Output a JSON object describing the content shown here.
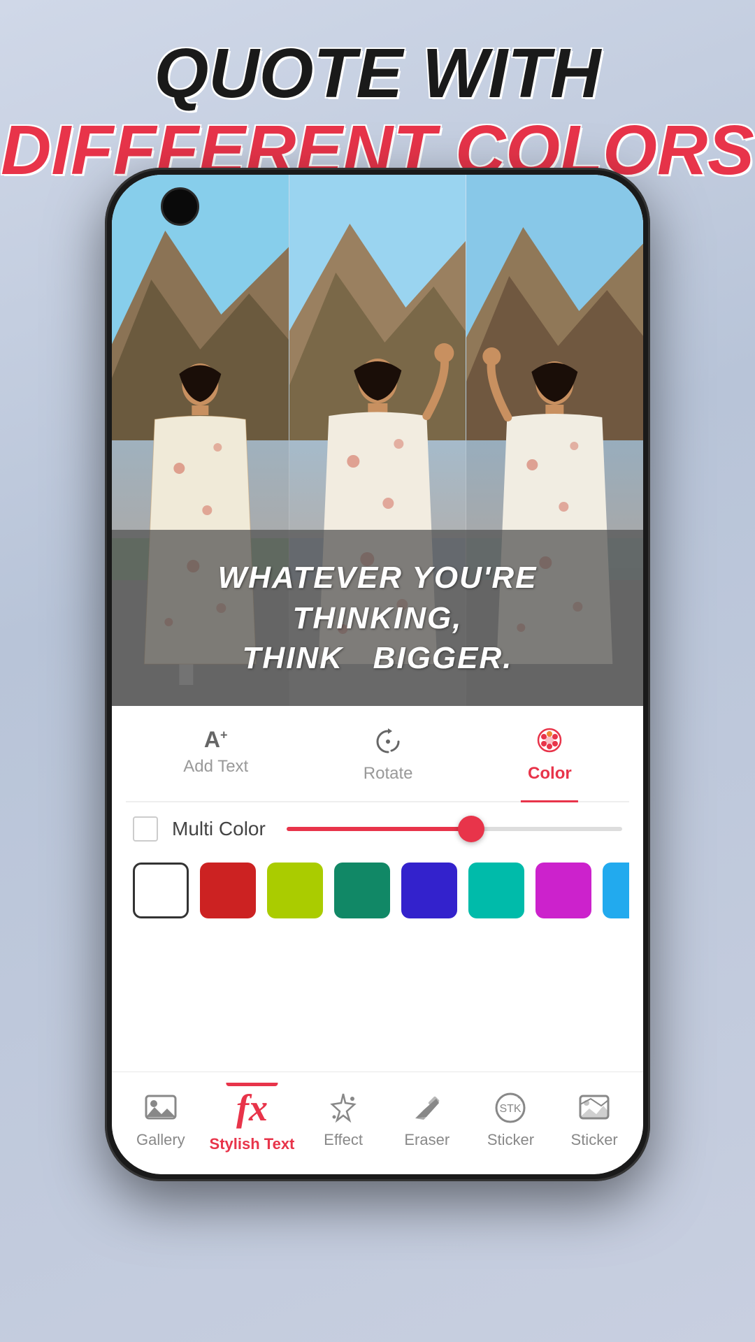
{
  "header": {
    "line1": "QUOTE WITH",
    "line2": "DIFFFERENT COLORS"
  },
  "image": {
    "quote": "WHATEVER YOU'RE THINKING,\nTHINK  BIGGER."
  },
  "toolbar": {
    "tabs": [
      {
        "id": "add-text",
        "label": "Add Text",
        "icon": "A+",
        "active": false
      },
      {
        "id": "rotate",
        "label": "Rotate",
        "icon": "⟳",
        "active": false
      },
      {
        "id": "color",
        "label": "Color",
        "icon": "🎨",
        "active": true
      }
    ],
    "multi_color_label": "Multi Color",
    "slider_value": 55,
    "colors": [
      {
        "id": "white",
        "hex": "#FFFFFF",
        "selected": true
      },
      {
        "id": "red",
        "hex": "#CC2222"
      },
      {
        "id": "lime",
        "hex": "#AACC00"
      },
      {
        "id": "teal",
        "hex": "#118866"
      },
      {
        "id": "blue",
        "hex": "#3322CC"
      },
      {
        "id": "cyan",
        "hex": "#00BBAA"
      },
      {
        "id": "magenta",
        "hex": "#CC22CC"
      },
      {
        "id": "sky",
        "hex": "#22AAEE"
      },
      {
        "id": "pink",
        "hex": "#EE2277"
      }
    ]
  },
  "bottom_nav": {
    "items": [
      {
        "id": "gallery",
        "label": "Gallery",
        "icon": "gallery",
        "active": false
      },
      {
        "id": "stylish-text",
        "label": "Stylish Text",
        "icon": "fx",
        "active": true
      },
      {
        "id": "effect",
        "label": "Effect",
        "icon": "effect",
        "active": false
      },
      {
        "id": "eraser",
        "label": "Eraser",
        "icon": "eraser",
        "active": false
      },
      {
        "id": "sticker",
        "label": "Sticker",
        "icon": "sticker",
        "active": false
      },
      {
        "id": "sticker2",
        "label": "Sticker",
        "icon": "sticker2",
        "active": false
      }
    ]
  }
}
